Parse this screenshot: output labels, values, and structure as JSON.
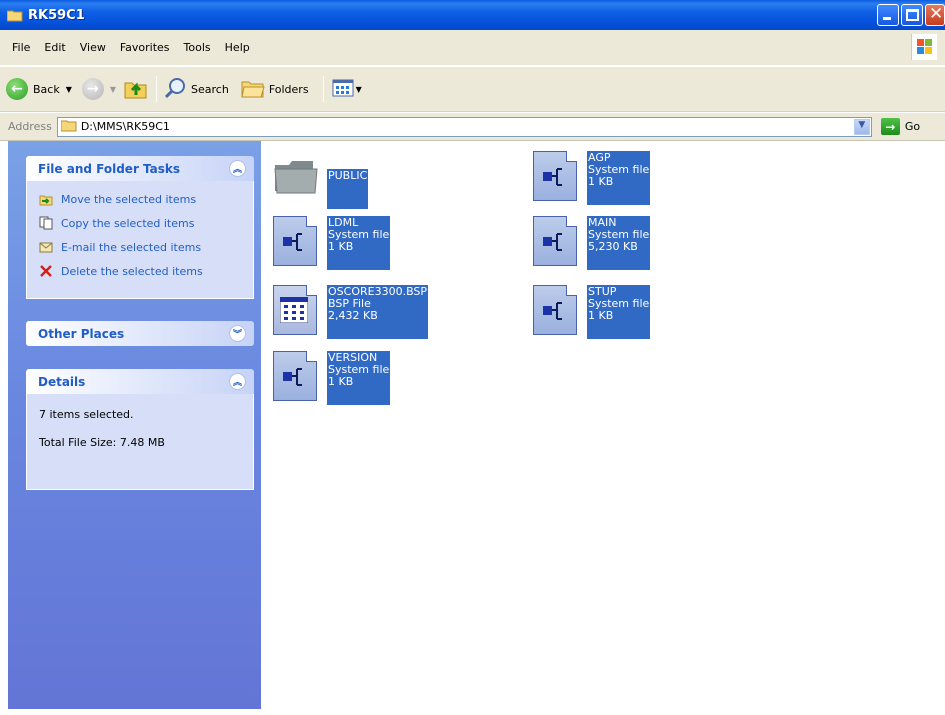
{
  "window": {
    "title": "RK59C1",
    "icon": "folder-icon"
  },
  "menu": [
    "File",
    "Edit",
    "View",
    "Favorites",
    "Tools",
    "Help"
  ],
  "toolbar": {
    "back_label": "Back",
    "search_label": "Search",
    "folders_label": "Folders"
  },
  "address": {
    "label": "Address",
    "value": "D:\\MMS\\RK59C1",
    "go_label": "Go"
  },
  "tasks_panel": {
    "title": "File and Folder Tasks",
    "items": [
      {
        "label": "Move the selected items",
        "icon": "move-icon"
      },
      {
        "label": "Copy the selected items",
        "icon": "copy-icon"
      },
      {
        "label": "E-mail the selected items",
        "icon": "email-icon"
      },
      {
        "label": "Delete the selected items",
        "icon": "delete-icon"
      }
    ]
  },
  "other_places": {
    "title": "Other Places"
  },
  "details": {
    "title": "Details",
    "selected_text": "7 items selected.",
    "size_text": "Total File Size: 7.48 MB"
  },
  "files": [
    {
      "name": "PUBLIC",
      "type": "",
      "size": "",
      "kind": "folder",
      "selected": true
    },
    {
      "name": "AGP",
      "type": "System file",
      "size": "1 KB",
      "kind": "system",
      "selected": true
    },
    {
      "name": "LDML",
      "type": "System file",
      "size": "1 KB",
      "kind": "system",
      "selected": true
    },
    {
      "name": "MAIN",
      "type": "System file",
      "size": "5,230 KB",
      "kind": "system",
      "selected": true
    },
    {
      "name": "OSCORE3300.BSP",
      "type": "BSP File",
      "size": "2,432 KB",
      "kind": "bsp",
      "selected": true
    },
    {
      "name": "STUP",
      "type": "System file",
      "size": "1 KB",
      "kind": "system",
      "selected": true
    },
    {
      "name": "VERSION",
      "type": "System file",
      "size": "1 KB",
      "kind": "system",
      "selected": true
    }
  ]
}
